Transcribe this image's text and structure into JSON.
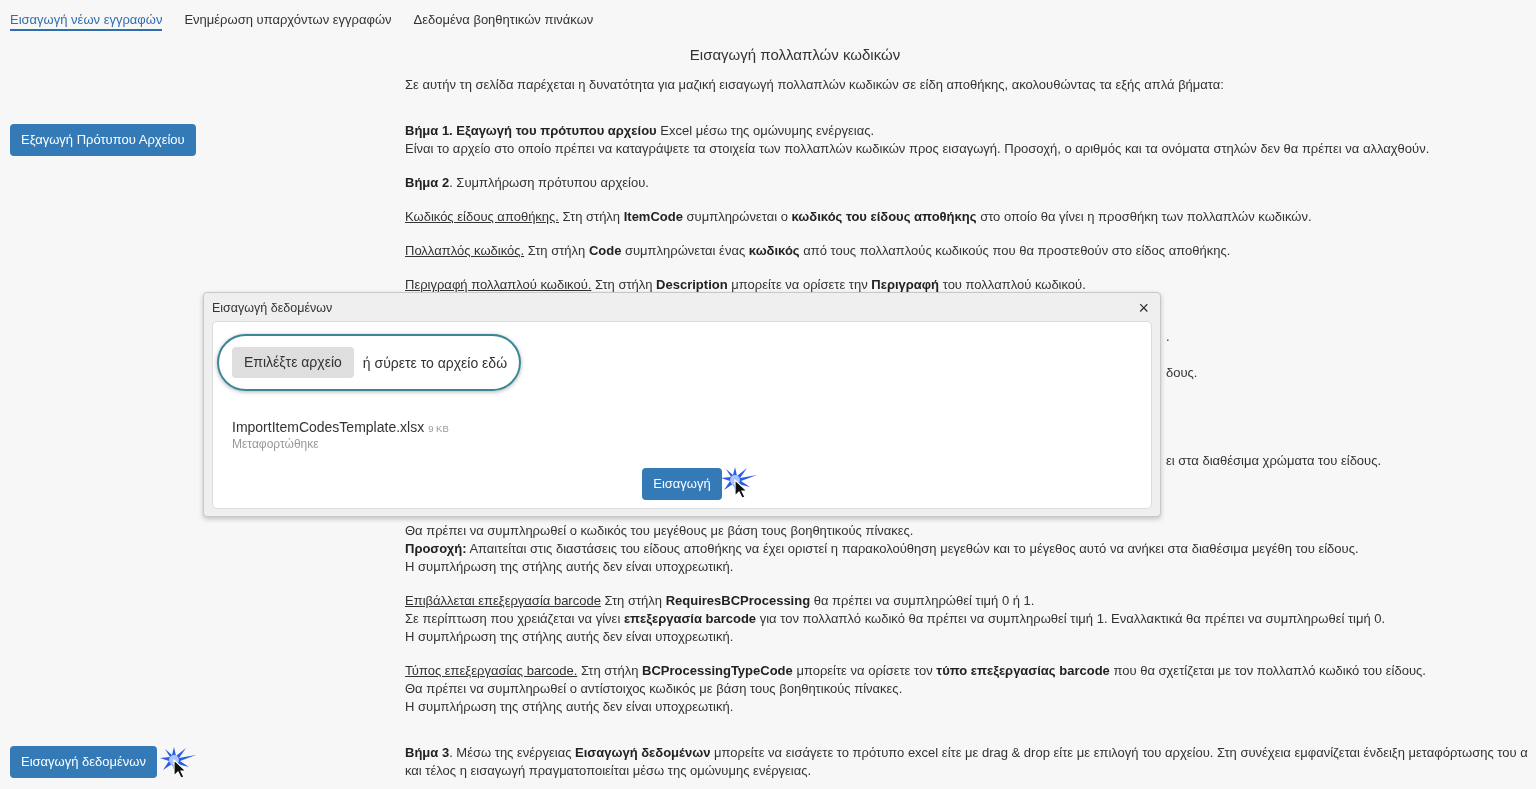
{
  "tabs": [
    {
      "label": "Εισαγωγή νέων εγγραφών",
      "selected": true
    },
    {
      "label": "Ενημέρωση υπαρχόντων εγγραφών",
      "selected": false
    },
    {
      "label": "Δεδομένα βοηθητικών πινάκων",
      "selected": false
    }
  ],
  "title": "Εισαγωγή πολλαπλών κωδικών",
  "intro": "Σε αυτήν τη σελίδα παρέχεται η δυνατότητα για μαζική εισαγωγή πολλαπλών κωδικών σε είδη αποθήκης, ακολουθώντας τα εξής απλά βήματα:",
  "sections": [
    {
      "button": {
        "label": "Εξαγωγή Πρότυπου Αρχείου",
        "clicked": false
      },
      "blocks": [
        {
          "kind": "paragraph",
          "lines": [
            "**Βήμα 1. Εξαγωγή του πρότυπου αρχείου** Excel μέσω της ομώνυμης ενέργειας.",
            "Είναι το αρχείο στο οποίο πρέπει να καταγράψετε τα στοιχεία των πολλαπλών κωδικών προς εισαγωγή. Προσοχή, ο αριθμός και τα ονόματα στηλών δεν θα πρέπει να αλλαχθούν."
          ]
        }
      ]
    },
    {
      "blocks": [
        {
          "kind": "paragraph",
          "lines": [
            "**Βήμα 2**. Συμπλήρωση πρότυπου αρχείου."
          ]
        },
        {
          "kind": "paragraph",
          "term": "Κωδικός είδους αποθήκης.",
          "lines": [
            "Στη στήλη **ItemCode** συμπληρώνεται ο **κωδικός του είδους αποθήκης** στο οποίο θα γίνει η προσθήκη των πολλαπλών κωδικών."
          ]
        },
        {
          "kind": "paragraph",
          "term": "Πολλαπλός κωδικός.",
          "lines": [
            "Στη στήλη **Code** συμπληρώνεται ένας **κωδικός** από τους πολλαπλούς κωδικούς που θα προστεθούν στο είδος αποθήκης."
          ]
        },
        {
          "kind": "paragraph",
          "term": "Περιγραφή πολλαπλού κωδικού.",
          "lines": [
            "Στη στήλη **Description** μπορείτε να ορίσετε την **Περιγραφή** του πολλαπλού κωδικού."
          ]
        },
        {
          "kind": "covered",
          "fragments": [
            ".",
            "δους.",
            "ει στα διαθέσιμα χρώματα του είδους."
          ]
        },
        {
          "kind": "paragraph",
          "lines": [
            "Θα πρέπει να συμπληρωθεί ο κωδικός του μεγέθους με βάση τους βοηθητικούς πίνακες.",
            "**Προσοχή:** Απαιτείται στις διαστάσεις του είδους αποθήκης να έχει οριστεί η παρακολούθηση μεγεθών και το μέγεθος αυτό να ανήκει στα διαθέσιμα μεγέθη του είδους.",
            "Η συμπλήρωση της στήλης αυτής δεν είναι υποχρεωτική."
          ]
        },
        {
          "kind": "paragraph",
          "term": "Επιβάλλεται επεξεργασία barcode",
          "lines": [
            "Στη στήλη **RequiresBCProcessing** θα πρέπει να συμπληρώθεί τιμή 0 ή 1.",
            "Σε περίπτωση που χρειάζεται να γίνει **επεξεργασία barcode** για τον πολλαπλό κωδικό θα πρέπει να συμπληρωθεί τιμή 1. Εναλλακτικά θα πρέπει να συμπληρωθεί τιμή 0.",
            "Η συμπλήρωση της στήλης αυτής δεν είναι υποχρεωτική."
          ]
        },
        {
          "kind": "paragraph",
          "term": "Τύπος επεξεργασίας barcode.",
          "lines": [
            "Στη στήλη **BCProcessingTypeCode** μπορείτε να ορίσετε τον **τύπο επεξεργασίας barcode** που θα σχετίζεται με τον πολλαπλό κωδικό του είδους.",
            "Θα πρέπει να συμπληρωθεί ο αντίστοιχος κωδικός με βάση τους βοηθητικούς πίνακες.",
            "Η συμπλήρωση της στήλης αυτής δεν είναι υποχρεωτική."
          ]
        }
      ]
    },
    {
      "button": {
        "label": "Εισαγωγή δεδομένων",
        "clicked": true
      },
      "blocks": [
        {
          "kind": "paragraph",
          "lines": [
            "**Βήμα 3**. Μέσω της ενέργειας **Εισαγωγή δεδομένων** μπορείτε να εισάγετε το πρότυπο excel είτε με drag & drop είτε με επιλογή του αρχείου. Στη συνέχεια εμφανίζεται ένδειξη μεταφόρτωσης του α",
            "και τέλος η εισαγωγή πραγματοποιείται μέσω της ομώνυμης ενέργειας."
          ]
        }
      ]
    }
  ],
  "modal": {
    "title": "Εισαγωγή δεδομένων",
    "close": "×",
    "choose_button": "Επιλέξτε αρχείο",
    "drop_hint": "ή σύρετε το αρχείο εδώ",
    "file": {
      "name": "ImportItemCodesTemplate.xlsx",
      "size": "9 KB",
      "status": "Μεταφορτώθηκε"
    },
    "submit": {
      "label": "Εισαγωγή",
      "clicked": true
    }
  }
}
